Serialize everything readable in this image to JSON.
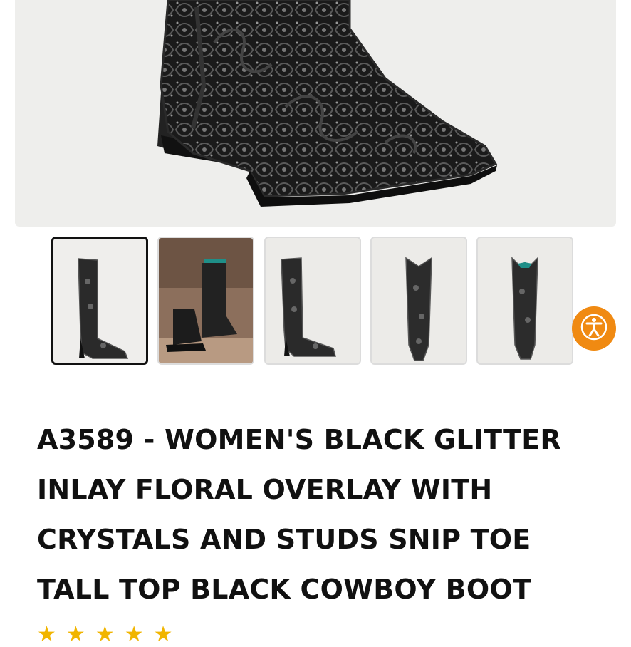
{
  "product": {
    "title": "A3589 - WOMEN'S BLACK GLITTER INLAY FLORAL OVERLAY WITH CRYSTALS AND STUDS SNIP TOE TALL TOP BLACK COWBOY BOOT",
    "rating_stars": 5
  },
  "gallery": {
    "selected_index": 0,
    "thumbnail_count": 5
  },
  "icons": {
    "accessibility": "accessibility-icon",
    "star": "star-icon"
  },
  "colors": {
    "accent_orange": "#f08a12",
    "star_gold": "#f1b500",
    "text": "#111111"
  }
}
